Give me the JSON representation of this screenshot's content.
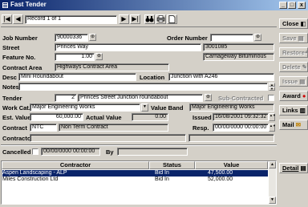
{
  "window": {
    "title": "Fast Tender",
    "min": "_",
    "max": "□",
    "close": "x"
  },
  "nav": {
    "first": "|◀",
    "prev": "◀",
    "record": "Record 1 of 1",
    "next": "▶",
    "last": "▶|"
  },
  "labels": {
    "job_number": "Job Number",
    "order_number": "Order Number",
    "street": "Street",
    "feature_no": "Feature No.",
    "contract_area": "Contract Area",
    "desc": "Desc",
    "location": "Location",
    "notes": "Notes",
    "tender": "Tender",
    "sub_contracted": "Sub-Contracted",
    "work_cat": "Work Cat.",
    "value_band": "Value Band",
    "est_value": "Est. Value",
    "actual_value": "Actual Value",
    "issued": "Issued",
    "contract": "Contract",
    "resp": "Resp.",
    "contractor": "Contractor",
    "cancelled": "Cancelled",
    "by": "By"
  },
  "fields": {
    "job_number": "90000336",
    "order_number": "",
    "street": "Princes Way",
    "street_code": "3001085",
    "feature_no": "1.00",
    "feature_desc": "Carriageway Bituminous",
    "contract_area": "Highways Contract Area",
    "desc": "Mini Roundabout",
    "location": "Junction with A246",
    "notes": "",
    "tender_no": "2",
    "tender_desc": "Princes Street Junction roundabout",
    "work_cat": "Major Engineering Works",
    "value_band": "Major Engineering Works",
    "est_value": "60,000.00",
    "actual_value": "0.00",
    "issued": "16/08/2001 09:32:32",
    "contract_code": "NTC",
    "contract_name": "Non Term Contract",
    "resp": "00/00/0000 00:00:00",
    "contractor": "",
    "cancelled_date": "00/00/0000 00:00:00",
    "cancelled_by": ""
  },
  "side_buttons": [
    {
      "label": "Close",
      "enabled": true
    },
    {
      "label": "Save",
      "enabled": false
    },
    {
      "label": "Restore",
      "enabled": false
    },
    {
      "label": "Delete",
      "enabled": false
    },
    {
      "label": "Issue",
      "enabled": false
    },
    {
      "label": "Award",
      "enabled": true
    },
    {
      "label": "Links",
      "enabled": true
    },
    {
      "label": "Mail",
      "enabled": true
    }
  ],
  "detail_button": "Detail",
  "grid": {
    "headers": [
      "Contractor",
      "Status",
      "Value"
    ],
    "rows": [
      {
        "contractor": "Aspen Landscaping - ALP",
        "status": "Bid In",
        "value": "47,500.00",
        "selected": true
      },
      {
        "contractor": "Miles Construction Ltd",
        "status": "Bid In",
        "value": "52,000.00",
        "selected": false
      }
    ]
  },
  "colors": {
    "title_from": "#0a246a",
    "title_to": "#a6caf0",
    "selection": "#0a246a",
    "face": "#d4d0c8"
  }
}
